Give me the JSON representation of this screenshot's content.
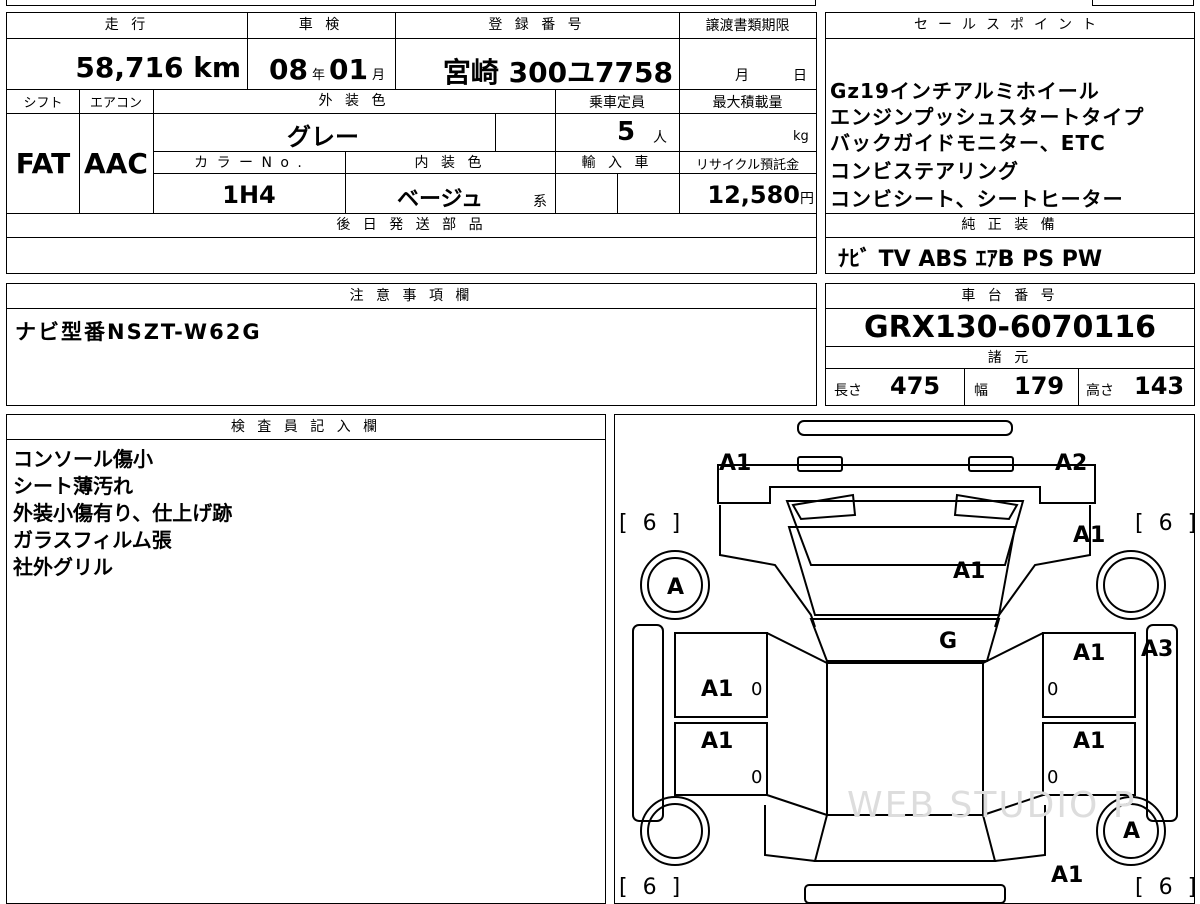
{
  "top": {
    "mileage_label": "走 行",
    "mileage_value": "58,716",
    "mileage_unit": "km",
    "inspection_label": "車 検",
    "inspection_year": "08",
    "inspection_year_unit": "年",
    "inspection_month": "01",
    "inspection_month_unit": "月",
    "reg_label": "登 録 番 号",
    "reg_value": "宮崎 300ユ7758",
    "transfer_label": "譲渡書類期限",
    "transfer_month_unit": "月",
    "transfer_day_unit": "日"
  },
  "row2": {
    "shift_label": "シフト",
    "ac_label": "エアコン",
    "exterior_label": "外 装 色",
    "capacity_label": "乗車定員",
    "maxload_label": "最大積載量",
    "shift_value": "FAT",
    "ac_value": "AAC",
    "exterior_value": "グレー",
    "capacity_value": "5",
    "capacity_unit": "人",
    "maxload_unit": "kg",
    "color_no_label": "カ ラ ー N o .",
    "interior_label": "内 装 色",
    "import_label": "輸 入 車",
    "recycle_label": "リサイクル預託金",
    "color_no_value": "1H4",
    "interior_value": "ベージュ",
    "interior_suffix": "系",
    "recycle_value": "12,580",
    "recycle_unit": "円",
    "later_parts_label": "後 日 発 送 部 品"
  },
  "sales": {
    "label": "セールスポイント",
    "lines": [
      "Gz19インチアルミホイール",
      "エンジンプッシュスタートタイプ",
      "バックガイドモニター、ETC",
      "コンビステアリング",
      "コンビシート、シートヒーター"
    ],
    "equipment_label": "純 正 装 備",
    "equipment_value": "ﾅﾋﾞ TV ABS ｴｱB PS PW"
  },
  "notes": {
    "label": "注 意 事 項 欄",
    "value": "ナビ型番NSZT-W62G"
  },
  "chassis": {
    "label": "車 台 番 号",
    "value": "GRX130-6070116",
    "spec_label": "諸 元",
    "length_label": "長さ",
    "length_value": "475",
    "width_label": "幅",
    "width_value": "179",
    "height_label": "高さ",
    "height_value": "143"
  },
  "inspector": {
    "label": "検 査 員 記 入 欄",
    "lines": [
      "コンソール傷小",
      "シート薄汚れ",
      "外装小傷有り、仕上げ跡",
      "ガラスフィルム張",
      "社外グリル"
    ]
  },
  "diagram": {
    "marks": {
      "front_left": "A1",
      "front_right": "A2",
      "right_fender": "A1",
      "hood": "A1",
      "windshield": "G",
      "right_front_door": "A1",
      "right_side_edge": "A3",
      "left_front_door": "A1",
      "left_rear_door": "A1",
      "right_rear_door": "A1",
      "rear_right": "A1",
      "wheel_front_left": "A",
      "wheel_rear_right": "A",
      "door_zero": "0"
    },
    "tires": {
      "front_left": "[ 6 ]",
      "front_right": "[ 6 ]",
      "rear_left": "[ 6 ]",
      "rear_right": "[ 6 ]"
    },
    "watermark": "WEB STUDIO P"
  }
}
